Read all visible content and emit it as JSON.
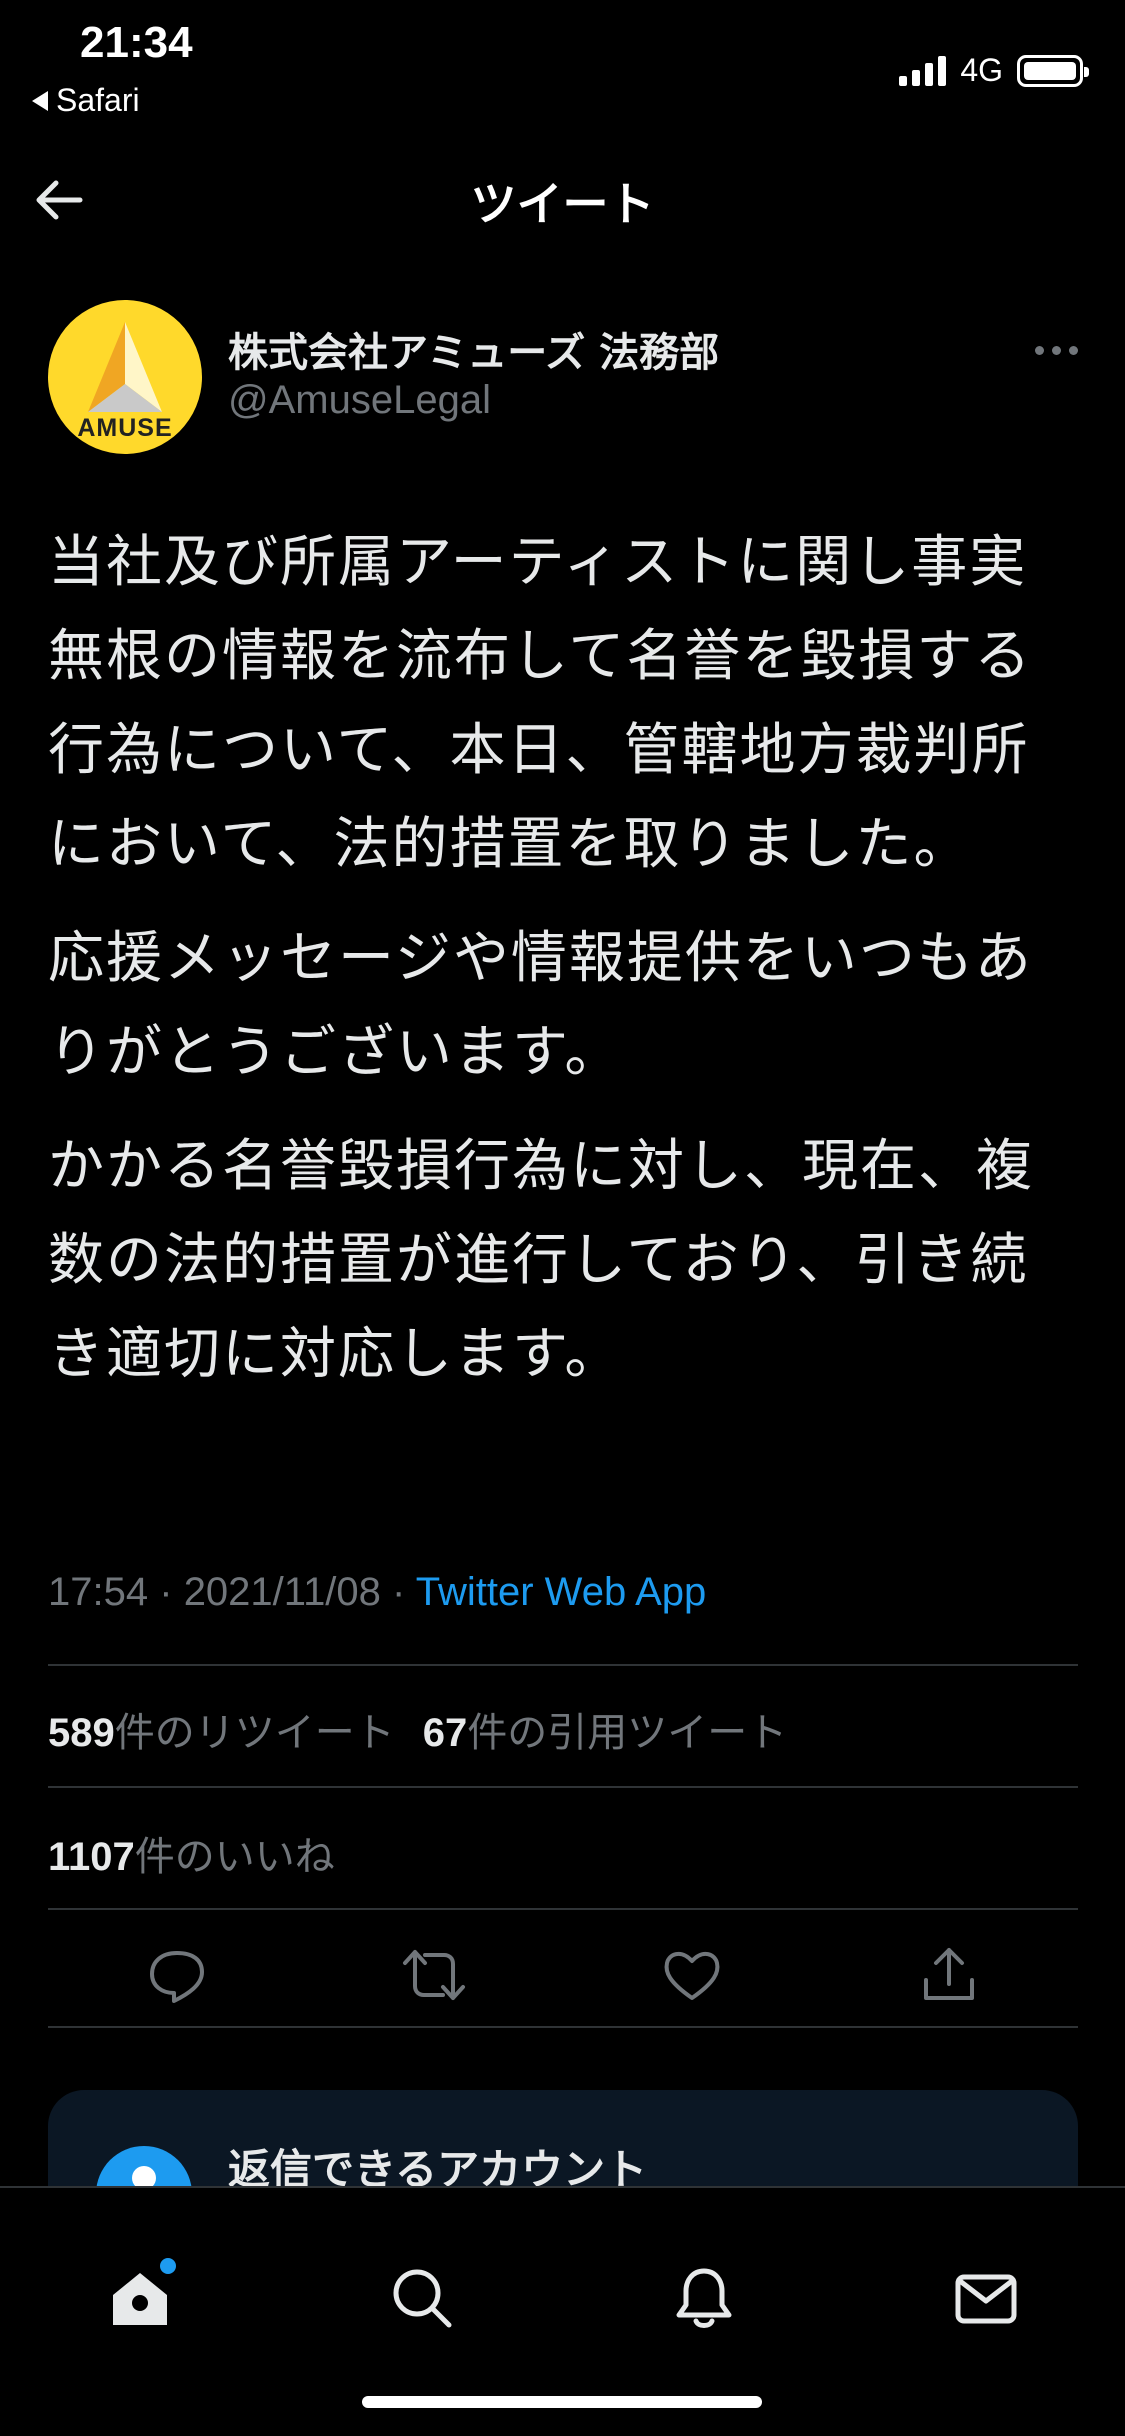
{
  "status_bar": {
    "time": "21:34",
    "back_app": "Safari",
    "network": "4G",
    "battery_level": 1.0
  },
  "header": {
    "title": "ツイート",
    "back_icon": "arrow-left-icon"
  },
  "tweet": {
    "author_name": "株式会社アミューズ 法務部",
    "author_handle": "@AmuseLegal",
    "avatar_text": "AMUSE",
    "paragraphs": [
      "当社及び所属アーティストに関し事実無根の情報を流布して名誉を毀損する行為について、本日、管轄地方裁判所において、法的措置を取りました。",
      "応援メッセージや情報提供をいつもありがとうございます。",
      "かかる名誉毀損行為に対し、現在、複数の法的措置が進行しており、引き続き適切に対応します。"
    ],
    "time": "17:54",
    "date": "2021/11/08",
    "separator": "·",
    "source": "Twitter Web App"
  },
  "stats": {
    "retweets_count": "589",
    "retweets_label": "件のリツイート",
    "quotes_count": "67",
    "quotes_label": "件の引用ツイート",
    "likes_count": "1107",
    "likes_label": "件のいいね"
  },
  "actions": [
    "reply-icon",
    "retweet-icon",
    "like-icon",
    "share-icon"
  ],
  "reply_card": {
    "title": "返信できるアカウント"
  },
  "tab_bar": [
    "home-icon",
    "search-icon",
    "notifications-icon",
    "messages-icon"
  ],
  "colors": {
    "background": "#000000",
    "text": "#e7e9ea",
    "secondary": "#71767b",
    "accent": "#1d9bf0",
    "avatar": "#ffd92b"
  }
}
